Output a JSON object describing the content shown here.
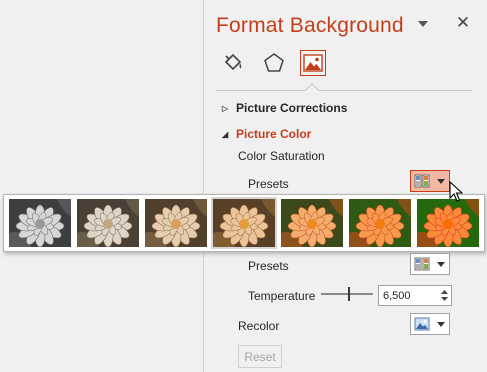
{
  "pane": {
    "title": "Format Background",
    "dropdown_icon": "triangle-down-icon",
    "close_glyph": "✕",
    "tabs": [
      {
        "name": "fill",
        "icon": "paint-bucket-icon",
        "active": false
      },
      {
        "name": "effects",
        "icon": "pentagon-icon",
        "active": false
      },
      {
        "name": "picture",
        "icon": "picture-icon",
        "active": true
      }
    ]
  },
  "sections": {
    "picture_corrections": {
      "label": "Picture Corrections",
      "expanded": false
    },
    "picture_color": {
      "label": "Picture Color",
      "expanded": true
    }
  },
  "color_saturation": {
    "label": "Color Saturation",
    "presets_label": "Presets"
  },
  "color_tone": {
    "presets_label": "Presets",
    "temperature_label": "Temperature",
    "temperature_value": "6,500",
    "temperature_level": 0.52
  },
  "recolor": {
    "label": "Recolor"
  },
  "reset_label": "Reset",
  "gallery": {
    "selected_index": 3,
    "thumbnails": [
      {
        "name": "saturation-0",
        "petal": "#d6d6d6",
        "center": "#9a9a9a",
        "bg": "#3e3e3e",
        "accent": "#6e6e6e"
      },
      {
        "name": "saturation-33",
        "petal": "#ded5c8",
        "center": "#c2a77e",
        "bg": "#4b4036",
        "accent": "#7d6f57"
      },
      {
        "name": "saturation-66",
        "petal": "#e6cdb0",
        "center": "#d9a057",
        "bg": "#52402e",
        "accent": "#8e7049"
      },
      {
        "name": "saturation-100",
        "petal": "#ecc39a",
        "center": "#e69a3b",
        "bg": "#5a3f27",
        "accent": "#9a7038"
      },
      {
        "name": "saturation-200",
        "petal": "#f4ad6f",
        "center": "#ef8a1d",
        "bg": "#3c4a1b",
        "accent": "#c15a20"
      },
      {
        "name": "saturation-300",
        "petal": "#f79a4f",
        "center": "#f27d10",
        "bg": "#2e5a14",
        "accent": "#d44a1a"
      },
      {
        "name": "saturation-400",
        "petal": "#fa8a3c",
        "center": "#f76e08",
        "bg": "#246a0c",
        "accent": "#e23c18"
      }
    ]
  },
  "colors": {
    "accent": "#c43e1c",
    "active_button_bg": "#f4b7a3",
    "panel_bg": "#f0f0f0"
  }
}
